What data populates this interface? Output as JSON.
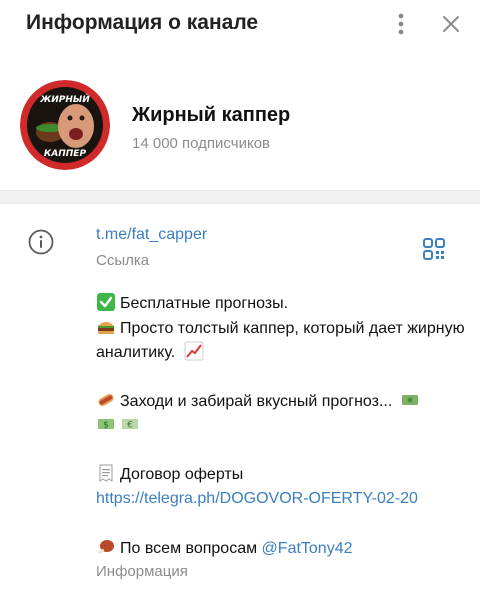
{
  "header": {
    "title": "Информация о канале",
    "menu_icon": "more-vertical-icon",
    "close_icon": "close-icon"
  },
  "channel": {
    "name": "Жирный каппер",
    "subscribers": "14 000 подписчиков",
    "avatar_text_top": "ЖИРНЫЙ",
    "avatar_text_bottom": "КАППЕР"
  },
  "link_section": {
    "icon": "info-icon",
    "link": "t.me/fat_capper",
    "link_label": "Ссылка",
    "qr_icon": "qr-code-icon"
  },
  "description": {
    "line1": "Бесплатные прогнозы.",
    "line2": "Просто толстый каппер, который дает жирную аналитику.",
    "line3": "Заходи и забирай вкусный прогноз...",
    "line4_label": "Договор оферты",
    "line4_link": "https://telegra.ph/DOGOVOR-OFERTY-02-20",
    "line5_text": "По всем вопросам",
    "line5_mention": "@FatTony42",
    "info_label": "Информация"
  },
  "colors": {
    "link": "#3a7fc0",
    "muted": "#8c8c8c",
    "avatar_ring": "#d12a2a"
  }
}
